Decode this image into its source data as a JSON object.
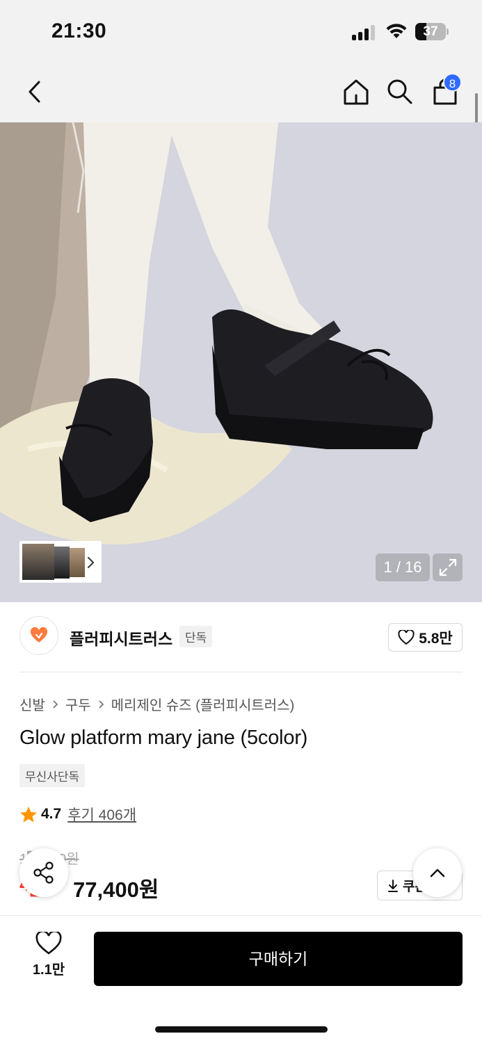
{
  "status_bar": {
    "time": "21:30",
    "battery_level": "37",
    "icons": [
      "signal-icon",
      "wifi-icon",
      "battery-icon"
    ]
  },
  "nav_bar": {
    "icons": [
      "back-icon",
      "home-icon",
      "search-icon",
      "cart-icon"
    ],
    "cart_count": "8"
  },
  "gallery": {
    "counter": "1 / 16",
    "current_image": 1,
    "total_images": 16,
    "icons": [
      "chevron-right-icon",
      "expand-icon"
    ]
  },
  "brand": {
    "name": "플러피시트러스",
    "badge": "단독",
    "like_count": "5.8만"
  },
  "breadcrumb": {
    "items": [
      "신발",
      "구두",
      "메리제인 슈즈 (플러피시트러스)"
    ]
  },
  "product": {
    "title": "Glow platform mary jane (5color)",
    "tag": "무신사단독",
    "rating": "4.7",
    "review_label": "후기 406개",
    "original_price": "1█,█00원",
    "discount_label": "4█%",
    "sale_price": "77,400원",
    "coupon_label": "쿠폰"
  },
  "bottom_bar": {
    "wish_count": "1.1만",
    "buy_label": "구매하기"
  },
  "colors": {
    "accent_blue": "#2f6bff",
    "discount_red": "#ff3b30",
    "star_orange": "#ff9500",
    "buy_button": "#000000"
  }
}
